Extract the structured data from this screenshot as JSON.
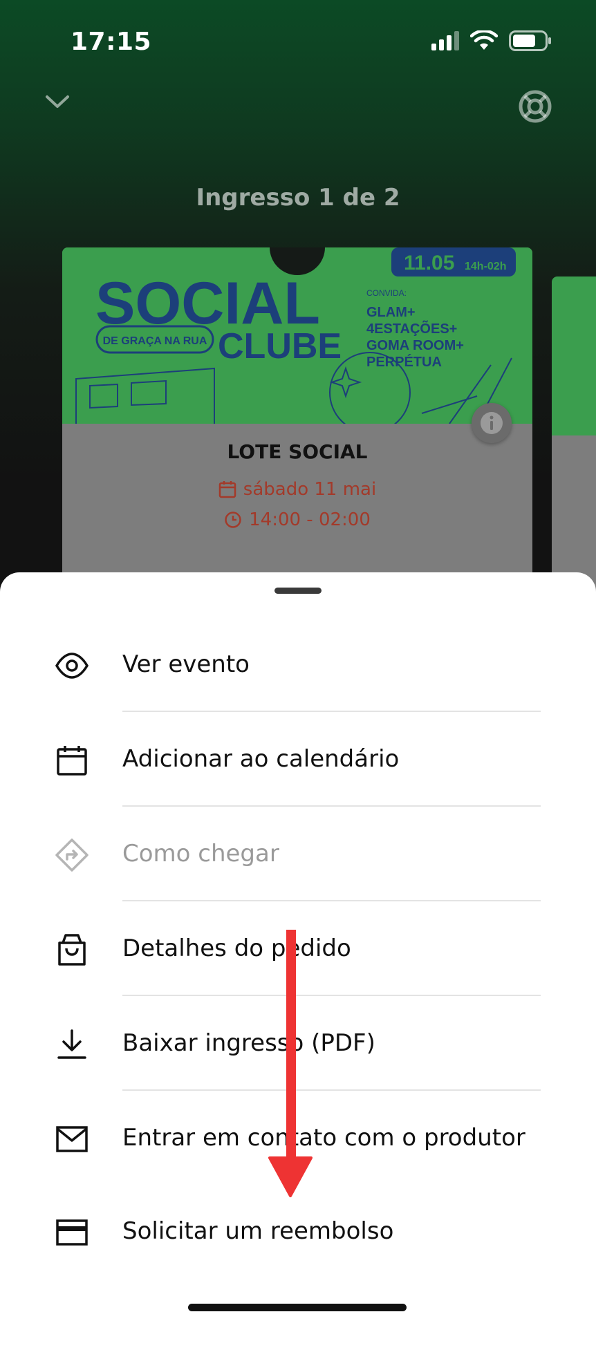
{
  "status_bar": {
    "time": "17:15"
  },
  "header": {
    "ticket_counter": "Ingresso 1 de 2"
  },
  "ticket": {
    "title": "LOTE SOCIAL",
    "date": "sábado 11 mai",
    "time": "14:00 - 02:00",
    "banner": {
      "date": "11.05",
      "hours": "14h-02h",
      "event_name_1": "SOCIAL",
      "event_name_2": "CLUBE",
      "tag": "DE GRAÇA NA RUA",
      "convida": "CONVIDA:",
      "lineup": [
        "GLAM+",
        "4ESTAÇÕES+",
        "GOMA ROOM+",
        "PERPÉTUA"
      ]
    }
  },
  "menu": {
    "items": [
      {
        "label": "Ver evento",
        "icon": "eye-icon",
        "enabled": true
      },
      {
        "label": "Adicionar ao calendário",
        "icon": "calendar-icon",
        "enabled": true
      },
      {
        "label": "Como chegar",
        "icon": "directions-icon",
        "enabled": false
      },
      {
        "label": "Detalhes do pedido",
        "icon": "shopping-bag-icon",
        "enabled": true
      },
      {
        "label": "Baixar ingresso (PDF)",
        "icon": "download-icon",
        "enabled": true
      },
      {
        "label": "Entrar em contato com o produtor",
        "icon": "mail-icon",
        "enabled": true
      },
      {
        "label": "Solicitar um reembolso",
        "icon": "credit-card-icon",
        "enabled": true
      }
    ]
  },
  "colors": {
    "banner_green": "#3b9e4e",
    "accent_red": "#a33a2a",
    "annotation_arrow": "#ee3333"
  }
}
